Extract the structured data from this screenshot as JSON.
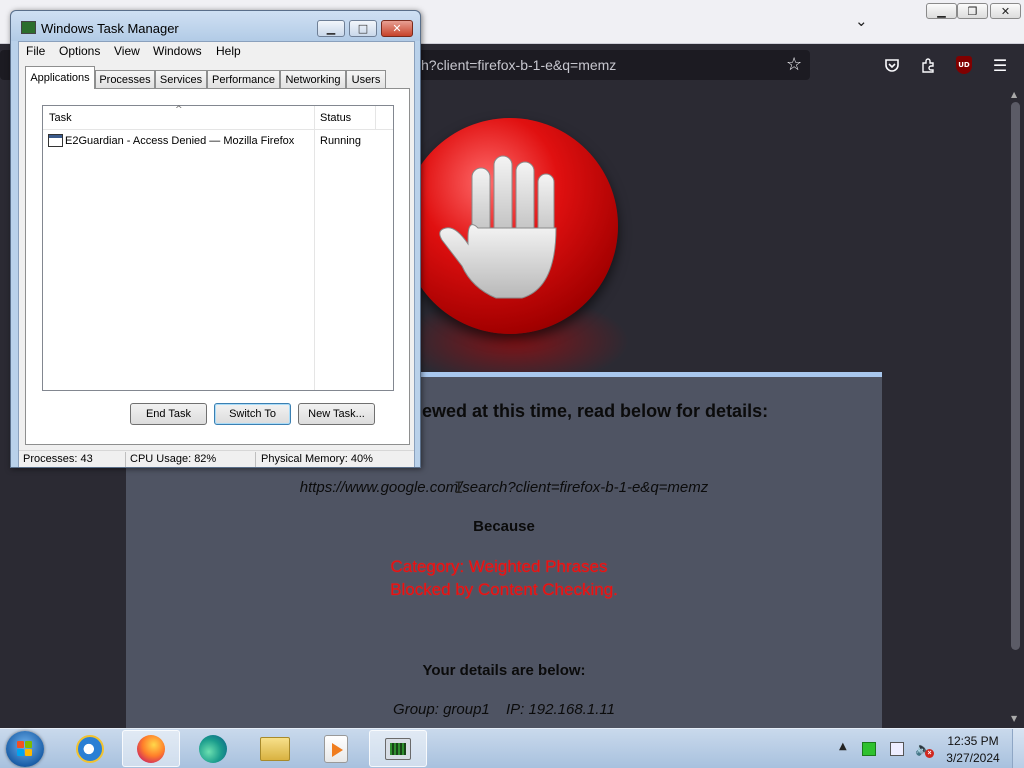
{
  "firefox": {
    "url_visible": "h?client=firefox-b-1-e&q=memz",
    "blocked_page": {
      "heading": "ewed at this time, read below for details:",
      "blocked_url": "https://www.google.com/search?client=firefox-b-1-e&q=memz",
      "because": "Because",
      "reason_line1": "Category: Weighted Phrases",
      "reason_line2": "Blocked by Content Checking.",
      "details_heading": "Your details are below:",
      "group": "Group: group1",
      "ip": "IP: 192.168.1.11"
    },
    "ublock_badge": "UD"
  },
  "task_manager": {
    "title": "Windows Task Manager",
    "menu": [
      "File",
      "Options",
      "View",
      "Windows",
      "Help"
    ],
    "tabs": [
      "Applications",
      "Processes",
      "Services",
      "Performance",
      "Networking",
      "Users"
    ],
    "active_tab": "Applications",
    "columns": {
      "task": "Task",
      "status": "Status"
    },
    "rows": [
      {
        "task": "E2Guardian - Access Denied — Mozilla Firefox",
        "status": "Running"
      }
    ],
    "buttons": {
      "end_task": "End Task",
      "switch_to": "Switch To",
      "new_task": "New Task..."
    },
    "status": {
      "processes": "Processes: 43",
      "cpu": "CPU Usage: 82%",
      "memory": "Physical Memory: 40%"
    }
  },
  "taskbar": {
    "items": [
      "internet-explorer",
      "firefox",
      "edge",
      "windows-explorer",
      "media-player",
      "task-manager"
    ],
    "active_item": "firefox",
    "clock_time": "12:35 PM",
    "clock_date": "3/27/2024"
  },
  "colors": {
    "firefox_chrome": "#2b2a33",
    "block_panel": "#4f5463",
    "reason_red": "#e81010",
    "taskbar": "#b9cde6"
  }
}
